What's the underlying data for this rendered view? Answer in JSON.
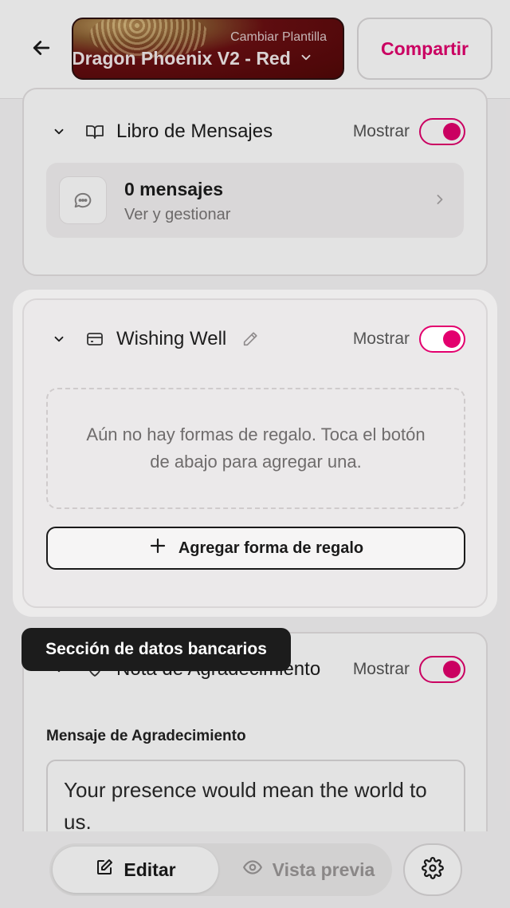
{
  "header": {
    "template_hint": "Cambiar Plantilla",
    "template_name": "Dragon Phoenix V2 - Red",
    "share_label": "Compartir"
  },
  "guestbook": {
    "title": "Libro de Mensajes",
    "show_label": "Mostrar",
    "enabled": true,
    "messages_count": "0 mensajes",
    "messages_sub": "Ver y gestionar"
  },
  "wishing_well": {
    "title": "Wishing Well",
    "show_label": "Mostrar",
    "enabled": true,
    "empty_text": "Aún no hay formas de regalo. Toca el botón de abajo para agregar una.",
    "add_button": "Agregar forma de regalo"
  },
  "tooltip": {
    "text": "Sección de datos bancarios"
  },
  "thanks": {
    "title": "Nota de Agradecimiento",
    "show_label": "Mostrar",
    "enabled": true,
    "field_label": "Mensaje de Agradecimiento",
    "message": "Your presence would mean the world to us."
  },
  "bottom_bar": {
    "edit_label": "Editar",
    "preview_label": "Vista previa",
    "active_tab": "Editar"
  },
  "colors": {
    "accent": "#e3006e",
    "template_bg": "#6a0f12"
  },
  "icons": {
    "back": "arrow-left-icon",
    "guestbook": "book-open-icon",
    "messages": "message-bubble-icon",
    "wishing_well": "credit-card-icon",
    "edit_title": "pencil-icon",
    "add": "plus-icon",
    "thanks": "heart-icon",
    "edit_tab": "edit-square-icon",
    "preview_tab": "eye-icon",
    "settings": "gear-icon"
  }
}
